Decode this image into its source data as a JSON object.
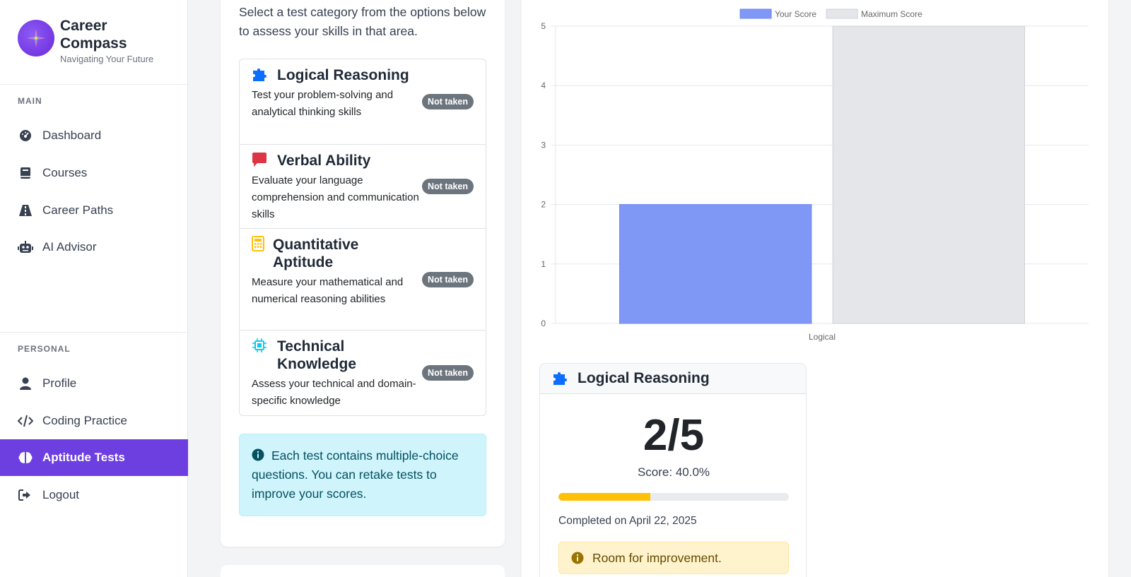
{
  "brand": {
    "title": "Career Compass",
    "subtitle": "Navigating Your Future"
  },
  "sidebar": {
    "main_label": "MAIN",
    "main_items": [
      {
        "label": "Dashboard",
        "icon": "gauge-icon"
      },
      {
        "label": "Courses",
        "icon": "book-icon"
      },
      {
        "label": "Career Paths",
        "icon": "road-icon"
      },
      {
        "label": "AI Advisor",
        "icon": "robot-icon"
      }
    ],
    "personal_label": "PERSONAL",
    "personal_items": [
      {
        "label": "Profile",
        "icon": "user-icon"
      },
      {
        "label": "Coding Practice",
        "icon": "code-icon"
      },
      {
        "label": "Aptitude Tests",
        "icon": "brain-icon",
        "active": true
      },
      {
        "label": "Logout",
        "icon": "logout-icon"
      }
    ]
  },
  "tests": {
    "intro": "Select a test category from the options below to assess your skills in that area.",
    "items": [
      {
        "title": "Logical Reasoning",
        "desc": "Test your problem-solving and analytical thinking skills",
        "status": "Not taken",
        "icon": "puzzle-icon",
        "color": "#0d6efd"
      },
      {
        "title": "Verbal Ability",
        "desc": "Evaluate your language comprehension and communication skills",
        "status": "Not taken",
        "icon": "comment-icon",
        "color": "#dc3545"
      },
      {
        "title": "Quantitative Aptitude",
        "desc": "Measure your mathematical and numerical reasoning abilities",
        "status": "Not taken",
        "icon": "calculator-icon",
        "color": "#ffc107"
      },
      {
        "title": "Technical Knowledge",
        "desc": "Assess your technical and domain-specific knowledge",
        "status": "Not taken",
        "icon": "microchip-icon",
        "color": "#0dcaf0"
      }
    ],
    "info": "Each test contains multiple-choice questions. You can retake tests to improve your scores."
  },
  "chart_data": {
    "type": "bar",
    "categories": [
      "Logical"
    ],
    "series": [
      {
        "name": "Your Score",
        "values": [
          2
        ],
        "color": "#7f97f5"
      },
      {
        "name": "Maximum Score",
        "values": [
          5
        ],
        "color": "#e4e6e9"
      }
    ],
    "ylim": [
      0,
      5
    ],
    "yticks": [
      0,
      1,
      2,
      3,
      4,
      5
    ],
    "legend": "top",
    "grid": true
  },
  "result": {
    "title": "Logical Reasoning",
    "score": "2/5",
    "score_text": "Score: 40.0%",
    "progress": 0.4,
    "completed": "Completed on April 22, 2025",
    "feedback": "Room for improvement."
  }
}
